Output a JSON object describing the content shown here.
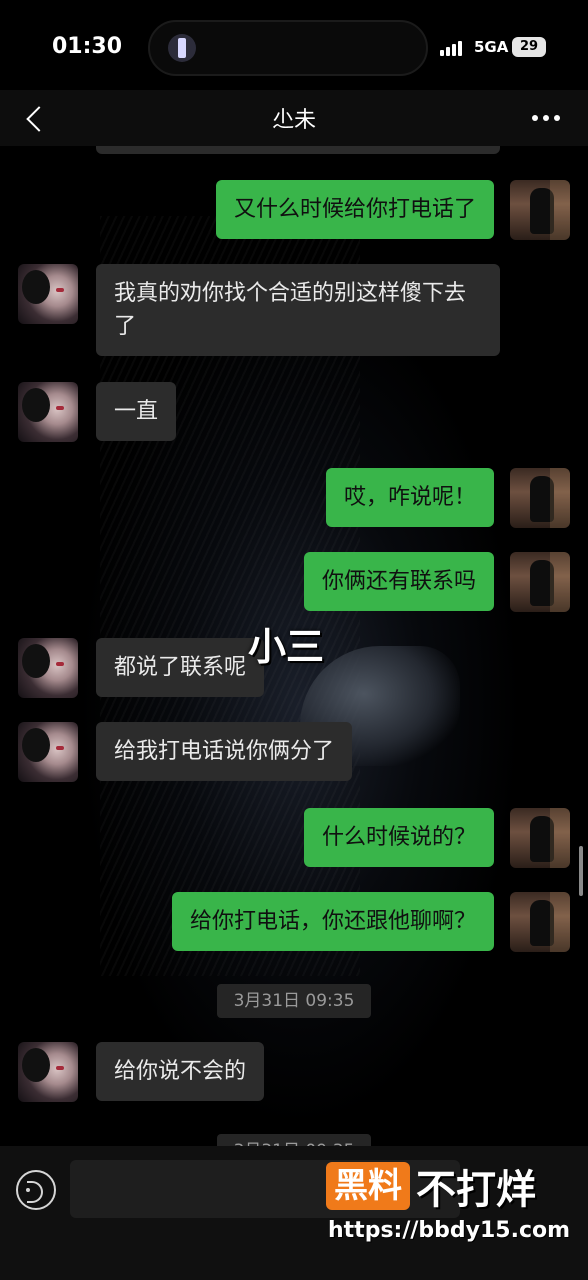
{
  "status_bar": {
    "time": "01:30",
    "network": "5GA",
    "battery": "29"
  },
  "header": {
    "title": "尐未"
  },
  "messages": [
    {
      "from": "me",
      "text": "又什么时候给你打电话了"
    },
    {
      "from": "them",
      "text": "我真的劝你找个合适的别这样傻下去了"
    },
    {
      "from": "them",
      "text": "一直"
    },
    {
      "from": "me",
      "text": "哎，咋说呢！"
    },
    {
      "from": "me",
      "text": "你俩还有联系吗"
    },
    {
      "from": "them",
      "text": "都说了联系呢"
    },
    {
      "from": "them",
      "text": "给我打电话说你俩分了"
    },
    {
      "from": "me",
      "text": "什么时候说的？"
    },
    {
      "from": "me",
      "text": "给你打电话，你还跟他聊啊？"
    },
    {
      "from": "them",
      "text": "给你说不会的"
    }
  ],
  "timestamp": "3月31日 09:35",
  "timestamp_partial": "3月31日 09:35",
  "overlay_label": "小三",
  "input": {
    "placeholder": ""
  },
  "watermark": {
    "box": "黑料",
    "text": "不打烊",
    "url": "https://bbdy15.com"
  },
  "colors": {
    "my_bubble": "#39b54a",
    "their_bubble": "#2c2c2c",
    "background": "#000000",
    "watermark_accent": "#f07a1a"
  }
}
